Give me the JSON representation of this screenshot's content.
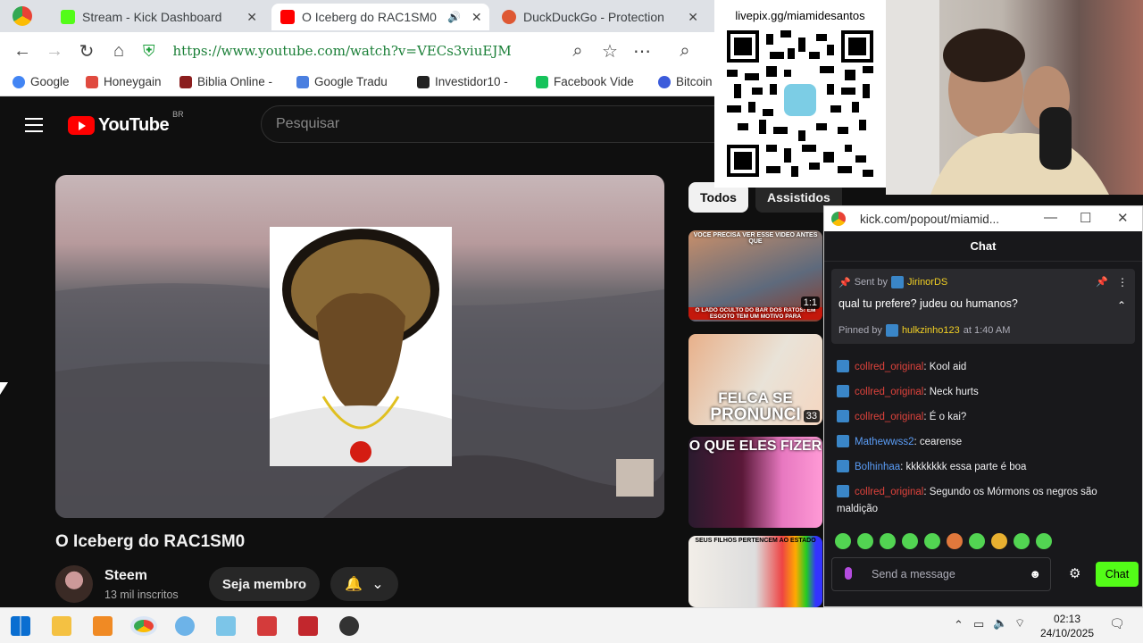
{
  "browser": {
    "tabs": [
      {
        "title": "Stream - Kick Dashboard",
        "close": "✕"
      },
      {
        "title": "O Iceberg do RAC1SM0",
        "close": "✕"
      },
      {
        "title": "DuckDuckGo - Protection",
        "close": "✕"
      }
    ],
    "url": "https://www.youtube.com/watch?v=VECs3viuEJM",
    "bookmarks": [
      "Google",
      "Honeygain",
      "Biblia Online -",
      "Google Tradu",
      "Investidor10 -",
      "Facebook Vide",
      "Bitcoin"
    ]
  },
  "youtube": {
    "logo_text": "YouTube",
    "country": "BR",
    "search_placeholder": "Pesquisar",
    "video_title": "O Iceberg do RAC1SM0",
    "channel_name": "Steem",
    "channel_subs": "13 mil inscritos",
    "join_label": "Seja membro",
    "chips": [
      "Todos",
      "Assistidos"
    ],
    "recommendations": [
      {
        "caption_top": "VOCE PRECISA VER ESSE VIDEO ANTES QUE",
        "caption_bottom": "O LADO OCULTO DO BAR DOS RATOS! EM ESGOTO TEM UM MOTIVO PARA",
        "duration": "1:1"
      },
      {
        "caption_top": "FELCA SE",
        "caption_bottom": "PRONUNCI",
        "duration": "33"
      },
      {
        "caption_top": "O QUE ELES FIZER",
        "caption_bottom": "",
        "duration": ""
      },
      {
        "caption_top": "SEUS FILHOS PERTENCEM AO ESTADO",
        "caption_bottom": "",
        "duration": ""
      }
    ]
  },
  "overlay": {
    "qr_label": "livepix.gg/miamidesantos"
  },
  "chat_window": {
    "title": "kick.com/popout/miamid...",
    "header": "Chat",
    "pinned": {
      "sent_by": "Sent by",
      "sender": "JirinorDS",
      "text": "qual tu prefere? judeu ou humanos?",
      "pinned_by": "Pinned by",
      "pinner": "hulkzinho123",
      "time": "at 1:40 AM"
    },
    "messages": [
      {
        "user": "collred_original",
        "text": "Kool aid",
        "color": "#e0433c"
      },
      {
        "user": "collred_original",
        "text": "Neck hurts",
        "color": "#e0433c"
      },
      {
        "user": "collred_original",
        "text": "É o kai?",
        "color": "#e0433c"
      },
      {
        "user": "Mathewwss2",
        "text": "cearense",
        "color": "#5a9cf5"
      },
      {
        "user": "Bolhinhaa",
        "text": "kkkkkkkk essa parte é boa",
        "color": "#5a9cf5"
      },
      {
        "user": "collred_original",
        "text": "Segundo os Mórmons os negros são maldição",
        "color": "#e0433c"
      }
    ],
    "send_placeholder": "Send a message",
    "chat_button": "Chat",
    "accent": "#53fc18"
  },
  "taskbar": {
    "time": "02:13",
    "date": "24/10/2025"
  }
}
